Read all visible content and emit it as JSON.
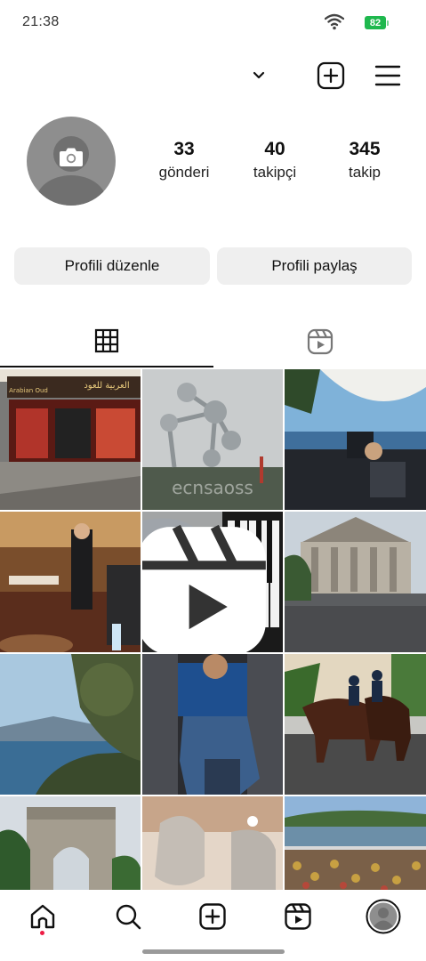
{
  "status_bar": {
    "time": "21:38",
    "battery": "82"
  },
  "profile": {
    "stats": [
      {
        "count": "33",
        "label": "gönderi"
      },
      {
        "count": "40",
        "label": "takipçi"
      },
      {
        "count": "345",
        "label": "takip"
      }
    ],
    "edit_button": "Profili düzenle",
    "share_button": "Profili paylaş"
  },
  "tabs": [
    {
      "icon": "grid-icon",
      "active": true
    },
    {
      "icon": "reels-icon",
      "active": false
    }
  ],
  "grid": {
    "posts": [
      {
        "subject": "shop front",
        "sign_text": "العربية للعود",
        "sign_subtext": "Arabian Oud"
      },
      {
        "subject": "atomium",
        "watermark": "ecnsaoss"
      },
      {
        "subject": "terrace"
      },
      {
        "subject": "restaurant"
      },
      {
        "subject": "piano",
        "is_reel": true
      },
      {
        "subject": "stock exchange"
      },
      {
        "subject": "coast"
      },
      {
        "subject": "seated man"
      },
      {
        "subject": "mounted police"
      },
      {
        "subject": "arc de triomphe"
      },
      {
        "subject": "silver teapot"
      },
      {
        "subject": "love locks"
      }
    ]
  },
  "bottom_nav": [
    {
      "icon": "home-icon",
      "active": true
    },
    {
      "icon": "search-icon"
    },
    {
      "icon": "create-icon"
    },
    {
      "icon": "reels-icon"
    },
    {
      "icon": "profile-avatar-icon"
    }
  ],
  "colors": {
    "battery": "#1fb84e",
    "button_bg": "#efefef",
    "notification_dot": "#ed1c45",
    "avatar_bg": "#8e8e8e"
  }
}
